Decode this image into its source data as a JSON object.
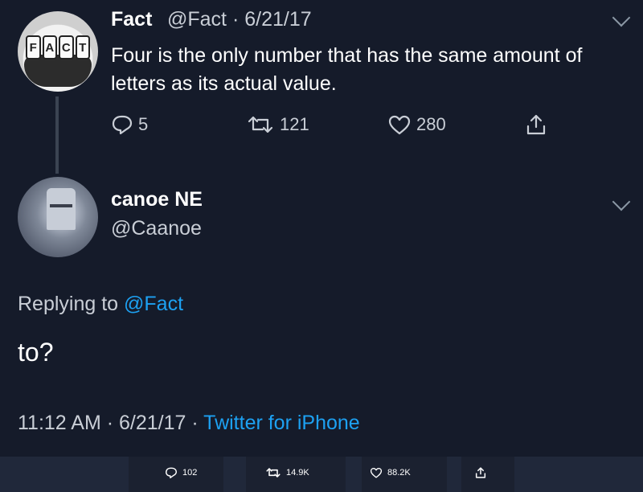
{
  "original_tweet": {
    "author_name": "Fact",
    "handle_date": "@Fact · 6/21/17",
    "text": "Four is the only number that has the same amount of letters as its actual value.",
    "avatar_letters": [
      "F",
      "A",
      "C",
      "T"
    ],
    "actions": {
      "replies": "5",
      "retweets": "121",
      "likes": "280"
    }
  },
  "reply_tweet": {
    "author_name": "canoe NE",
    "handle": "@Caanoe",
    "replying_prefix": "Replying to",
    "replying_mention": "@Fact",
    "text": "to?",
    "time_date": "11:12 AM · 6/21/17 ·",
    "source": "Twitter for iPhone"
  },
  "bottom_bar": {
    "replies": "102",
    "retweets": "14.9K",
    "likes": "88.2K"
  },
  "colors": {
    "background": "#151b2a",
    "link": "#1da1f2",
    "muted_text": "#c9ced6"
  },
  "icons": [
    "reply-icon",
    "retweet-icon",
    "like-icon",
    "share-icon",
    "chevron-down-icon"
  ]
}
